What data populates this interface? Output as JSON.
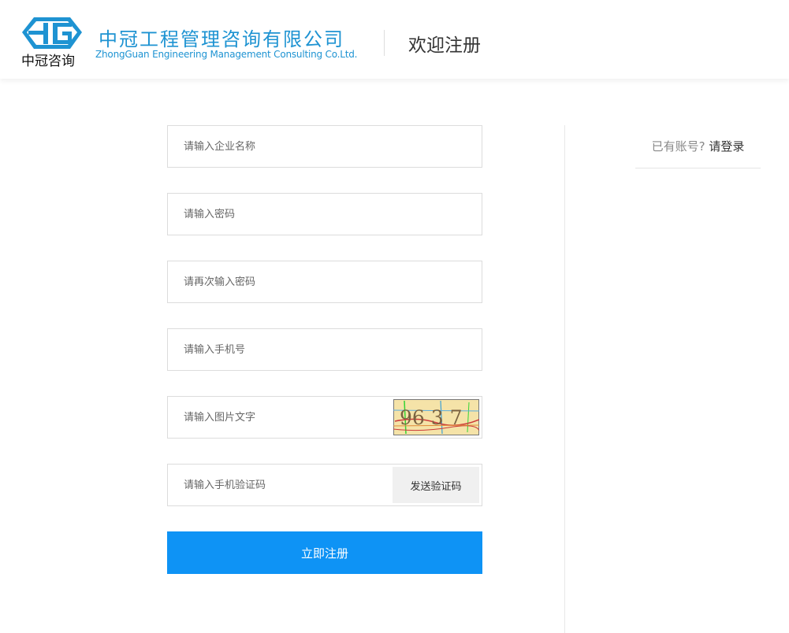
{
  "header": {
    "logo_text": "中冠咨询",
    "company_name_cn": "中冠工程管理咨询有限公司",
    "company_name_en": "ZhongGuan Engineering Management Consulting Co.Ltd.",
    "page_title": "欢迎注册",
    "brand_color": "#1e93d2"
  },
  "form": {
    "company_name": {
      "placeholder": "请输入企业名称",
      "value": ""
    },
    "password": {
      "placeholder": "请输入密码",
      "value": ""
    },
    "password_confirm": {
      "placeholder": "请再次输入密码",
      "value": ""
    },
    "phone": {
      "placeholder": "请输入手机号",
      "value": ""
    },
    "captcha": {
      "placeholder": "请输入图片文字",
      "value": "",
      "image_text": "96 3 7"
    },
    "sms_code": {
      "placeholder": "请输入手机验证码",
      "value": "",
      "button_label": "发送验证码"
    },
    "submit_label": "立即注册",
    "submit_color": "#0e93f5"
  },
  "login": {
    "question": "已有账号?",
    "link": "请登录"
  },
  "icons": {
    "logo": "zg-logo-icon"
  }
}
